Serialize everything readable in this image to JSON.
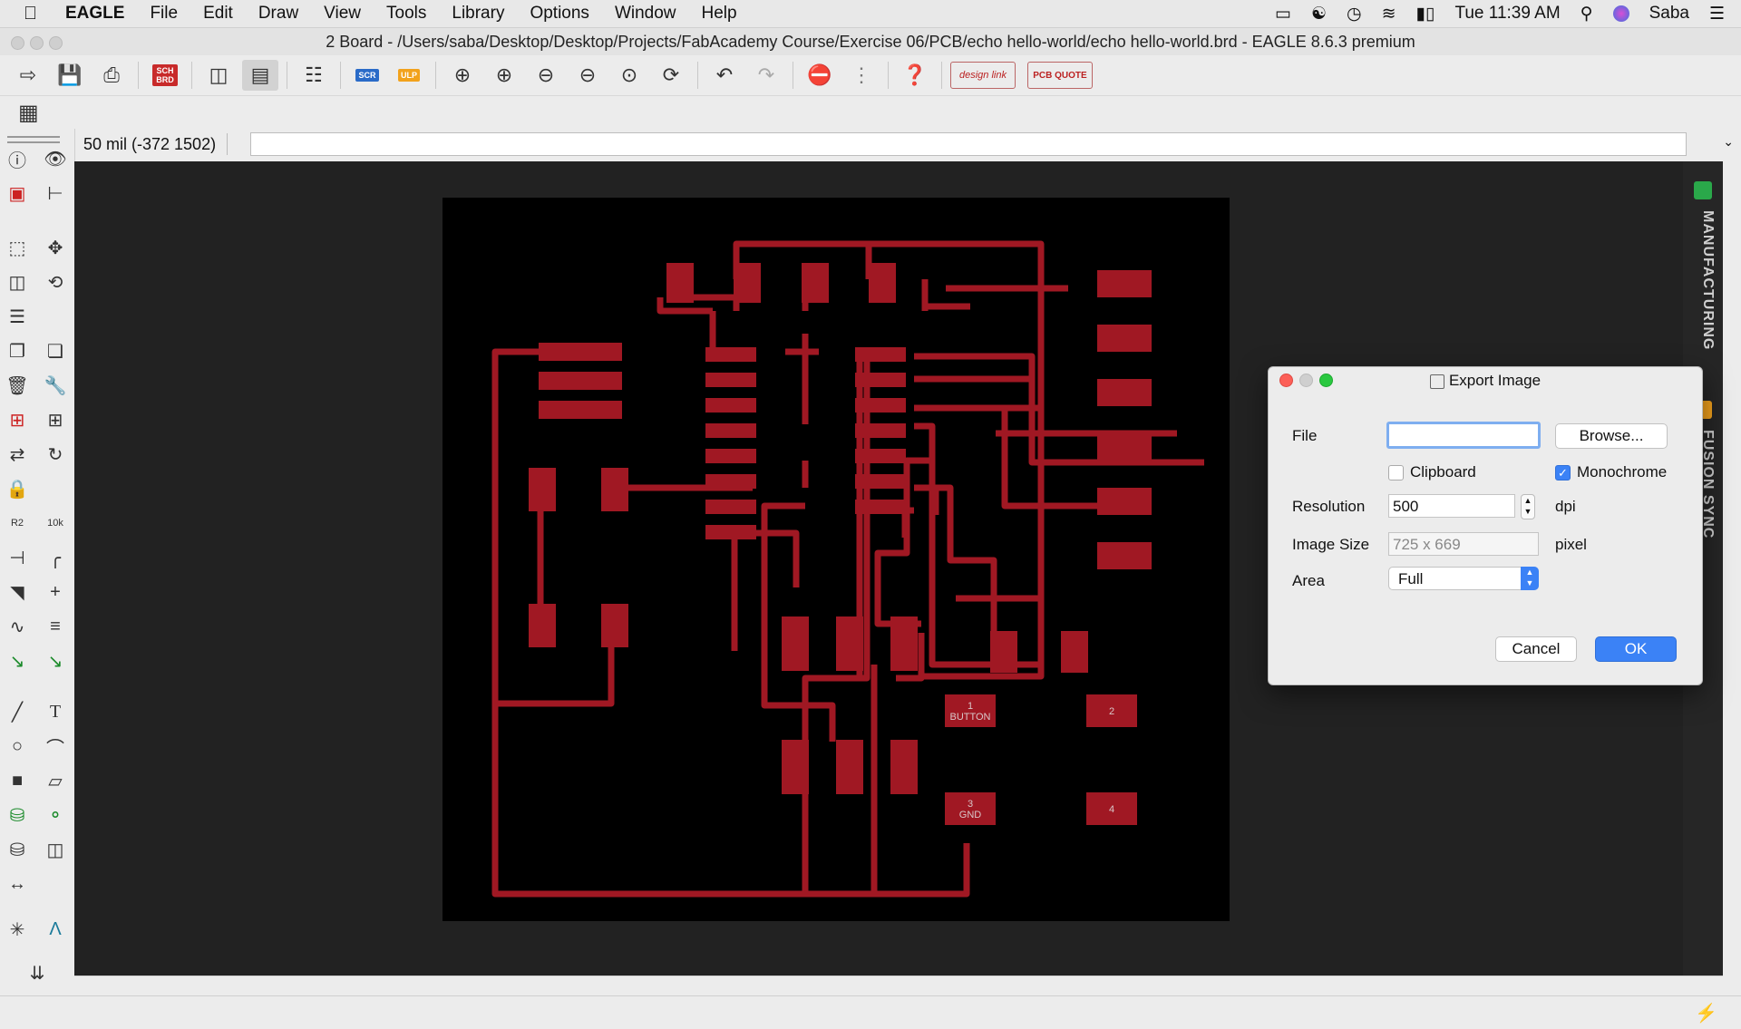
{
  "menubar": {
    "app": "EAGLE",
    "items": [
      "File",
      "Edit",
      "Draw",
      "View",
      "Tools",
      "Library",
      "Options",
      "Window",
      "Help"
    ],
    "clock": "Tue 11:39 AM",
    "user": "Saba"
  },
  "window": {
    "title": "2 Board - /Users/saba/Desktop/Desktop/Projects/FabAcademy Course/Exercise 06/PCB/echo hello-world/echo hello-world.brd - EAGLE 8.6.3 premium"
  },
  "toolbar": {
    "sch_badge": "SCH BRD",
    "scr_badge": "SCR",
    "ulp_badge": "ULP",
    "design_link": "design link",
    "pcb_quote": "PCB QUOTE"
  },
  "coordbar": {
    "readout": "50 mil (-372 1502)",
    "command": ""
  },
  "board": {
    "labels": {
      "button": "BUTTON",
      "gnd": "GND",
      "pad1": "1",
      "pad2": "2",
      "pad3": "3",
      "pad4": "4"
    },
    "trace_color": "#a01823"
  },
  "right_panel": {
    "manufacturing": "MANUFACTURING",
    "fusion_sync": "FUSION SYNC"
  },
  "dialog": {
    "title": "Export Image",
    "file_label": "File",
    "file_value": "",
    "browse_label": "Browse...",
    "clipboard_label": "Clipboard",
    "clipboard_checked": false,
    "monochrome_label": "Monochrome",
    "monochrome_checked": true,
    "resolution_label": "Resolution",
    "resolution_value": "500",
    "resolution_unit": "dpi",
    "image_size_label": "Image Size",
    "image_size_value": "725 x 669",
    "image_size_unit": "pixel",
    "area_label": "Area",
    "area_value": "Full",
    "cancel_label": "Cancel",
    "ok_label": "OK"
  },
  "icons": [
    "apple-icon",
    "airplay-icon",
    "wifi-icon",
    "battery-icon",
    "spotlight-icon",
    "siri-icon",
    "menu-list-icon",
    "info-icon",
    "eye-icon",
    "grid-icon",
    "lightning-icon"
  ]
}
